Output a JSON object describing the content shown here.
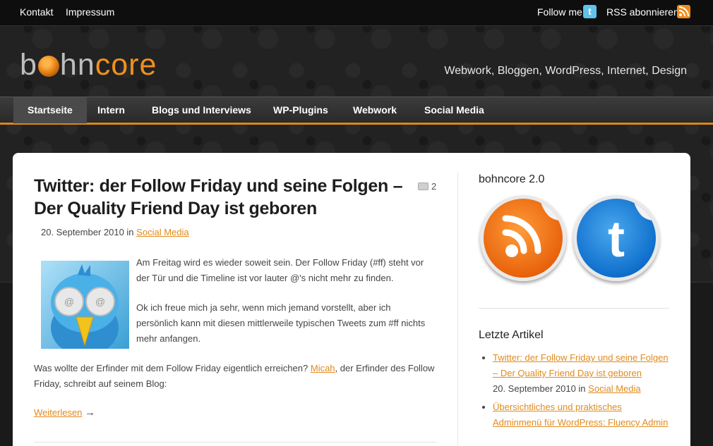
{
  "topbar": {
    "kontakt": "Kontakt",
    "impressum": "Impressum",
    "follow": "Follow me",
    "rss": "RSS abonnieren"
  },
  "header": {
    "logo_b": "b",
    "logo_hn": "hn",
    "logo_core": "core",
    "tagline": "Webwork, Bloggen, WordPress, Internet, Design"
  },
  "nav": {
    "items": [
      "Startseite",
      "Intern",
      "Blogs und Interviews",
      "WP-Plugins",
      "Webwork",
      "Social Media"
    ]
  },
  "post": {
    "title": "Twitter: der Follow Friday und seine Folgen – Der Quality Friend Day ist geboren",
    "comments": "2",
    "date": "20. September 2010 in",
    "category": "Social Media",
    "p1": "Am Freitag wird es wieder soweit sein. Der Follow Friday (#ff) steht vor der Tür und die Timeline ist vor lauter @'s nicht mehr zu finden.",
    "p2": "Ok ich freue mich ja sehr, wenn mich jemand vorstellt, aber ich persönlich kann mit diesen mittlerweile typischen Tweets zum #ff nichts mehr anfangen.",
    "p3_a": "Was wollte der Erfinder mit dem Follow Friday eigentlich erreichen?",
    "p3_link": "Micah",
    "p3_b": ", der Erfinder des Follow Friday, schreibt auf seinem Blog:",
    "more": "Weiterlesen",
    "arrow": "→"
  },
  "sidebar": {
    "heading1": "bohncore 2.0",
    "heading2": "Letzte Artikel",
    "articles": [
      {
        "title": "Twitter: der Follow Friday und seine Folgen – Der Quality Friend Day ist geboren",
        "date": "20. September 2010 in",
        "category": "Social Media"
      },
      {
        "title": "Übersichtliches und praktisches Adminmenü für WordPress: Fluency Admin",
        "date": "",
        "category": ""
      }
    ]
  },
  "colors": {
    "accent": "#e08a1c",
    "twitter": "#5fc3ea",
    "rss": "#f08c1e"
  }
}
